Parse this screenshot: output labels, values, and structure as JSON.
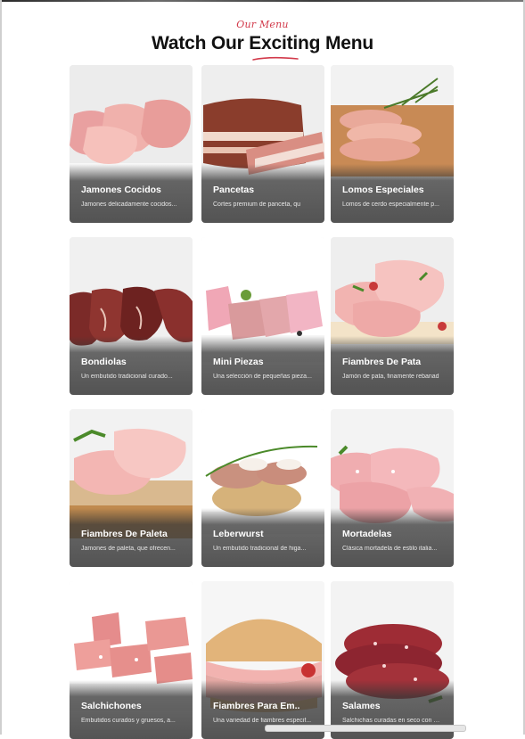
{
  "header": {
    "kicker": "Our Menu",
    "title": "Watch Our Exciting Menu",
    "accent_color": "#d23a4b"
  },
  "menu": {
    "items": [
      {
        "title": "Jamones Cocidos",
        "description": "Jamones delicadamente cocidos..."
      },
      {
        "title": "Pancetas",
        "description": "Cortes premium de panceta, qu"
      },
      {
        "title": "Lomos Especiales",
        "description": "Lomos de cerdo especialmente p..."
      },
      {
        "title": "Bondiolas",
        "description": "Un embutido tradicional curado..."
      },
      {
        "title": "Mini Piezas",
        "description": "Una selección de pequeñas pieza..."
      },
      {
        "title": "Fiambres De Pata",
        "description": "Jamón de pata, finamente rebanad"
      },
      {
        "title": "Fiambres De Paleta",
        "description": "Jamones de paleta, que ofrecen..."
      },
      {
        "title": "Leberwurst",
        "description": "Un embutido tradicional de higa..."
      },
      {
        "title": "Mortadelas",
        "description": "Clásica mortadela de estilo italia..."
      },
      {
        "title": "Salchichones",
        "description": "Embutidos curados y gruesos, a..."
      },
      {
        "title": "Fiambres Para Em..",
        "description": "Una variedad de fiambres especif..."
      },
      {
        "title": "Salames",
        "description": "Salchichas curadas en seco con u..."
      }
    ]
  }
}
